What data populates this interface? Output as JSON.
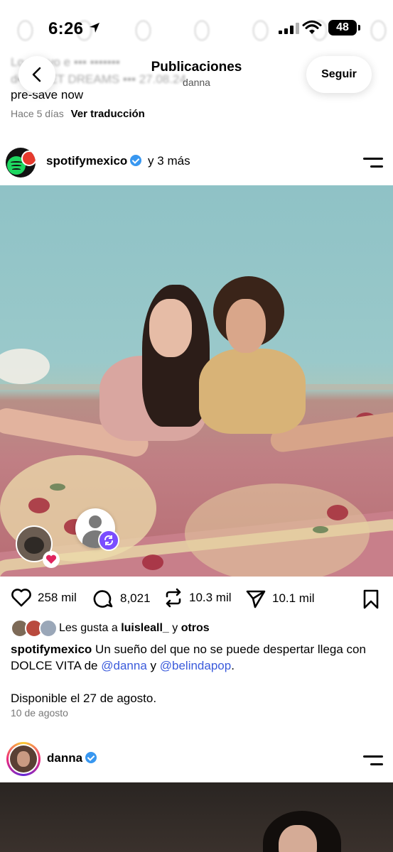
{
  "status_bar": {
    "time": "6:26",
    "battery": "48"
  },
  "previous_post": {
    "caption_tail": "pre-save now",
    "meta_time": "Hace 5 días",
    "meta_translate": "Ver traducción"
  },
  "header": {
    "title": "Publicaciones",
    "subtitle": "danna",
    "follow_label": "Seguir"
  },
  "post": {
    "username": "spotifymexico",
    "collab_text": "y 3 más",
    "likes_count": "258 mil",
    "comments_count": "8,021",
    "reposts_count": "10.3 mil",
    "shares_count": "10.1 mil",
    "likes_prefix": "Les gusta a",
    "likes_user": "luisleall_",
    "likes_joiner": "y",
    "likes_suffix": "otros",
    "caption_user": "spotifymexico",
    "caption_text": "Un sueño del que no se puede despertar llega con DOLCE VITA de",
    "mention1": "@danna",
    "caption_and": "y",
    "mention2": "@belindapop",
    "caption_period": ".",
    "caption_line2": "Disponible el 27 de agosto.",
    "date": "10 de agosto"
  },
  "next_post": {
    "username": "danna"
  },
  "colors": {
    "verified": "#3897f0",
    "mention": "#3b5bdb",
    "spotify_green": "#1ed760",
    "repost_badge": "#7b4dff",
    "heart": "#e0245e"
  },
  "icons": [
    "back-icon",
    "heart-icon",
    "comment-icon",
    "repost-icon",
    "share-icon",
    "bookmark-icon",
    "menu-icon",
    "verified-icon"
  ]
}
